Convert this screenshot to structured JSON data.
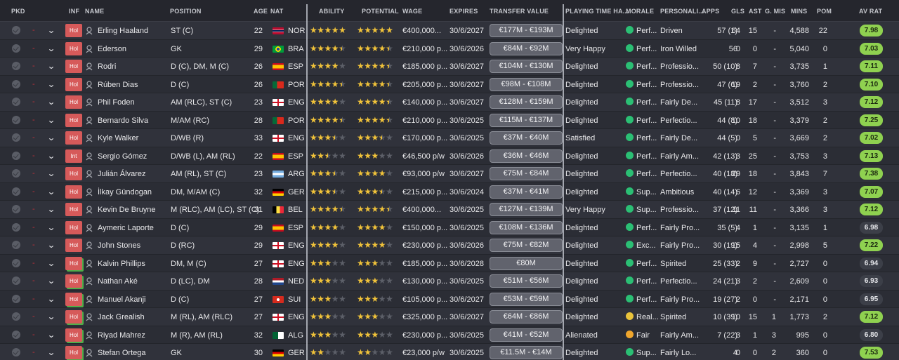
{
  "columns": [
    "PKD",
    "INF",
    "NAME",
    "POSITION",
    "AGE",
    "NAT",
    "ABILITY",
    "POTENTIAL",
    "WAGE",
    "EXPIRES",
    "TRANSFER VALUE",
    "PLAYING TIME HA...",
    "MORALE",
    "PERSONALI...",
    "APPS",
    "GLS",
    "AST",
    "G. MIS",
    "MINS",
    "POM",
    "AV RAT"
  ],
  "colors": {
    "rating_green": "#8fd150",
    "rating_dark": "#3c3f48",
    "badge": "#d65a5a",
    "star": "#f1c33a"
  },
  "players": [
    {
      "inf": "Hol",
      "name": "Erling Haaland",
      "position": "ST (C)",
      "age": "22",
      "flag": "NOR",
      "nat": "NOR",
      "ability": 5,
      "potential": 5,
      "wage": "€400,000...",
      "expires": "30/6/2027",
      "tv": "€177M - €193M",
      "pt": "Delighted",
      "morale": "Perf...",
      "mi": "up",
      "personality": "Driven",
      "apps": "57 (1)",
      "gls": "64",
      "ast": "15",
      "gmis": "-",
      "mins": "4,588",
      "pom": "22",
      "rating": "7.98",
      "rgreen": true
    },
    {
      "inf": "Hol",
      "name": "Ederson",
      "position": "GK",
      "age": "29",
      "flag": "BRA",
      "nat": "BRA",
      "ability": 4.5,
      "potential": 4.5,
      "wage": "€210,000 p...",
      "expires": "30/6/2026",
      "tv": "€84M - €92M",
      "pt": "Very Happy",
      "morale": "Perf...",
      "mi": "up",
      "personality": "Iron Willed",
      "apps": "56",
      "gls": "0",
      "ast": "0",
      "gmis": "-",
      "mins": "5,040",
      "pom": "0",
      "rating": "7.03",
      "rgreen": true
    },
    {
      "inf": "Hol",
      "name": "Rodri",
      "position": "D (C), DM, M (C)",
      "age": "26",
      "flag": "ESP",
      "nat": "ESP",
      "ability": 4,
      "potential": 4.5,
      "wage": "€185,000 p...",
      "expires": "30/6/2027",
      "tv": "€104M - €130M",
      "pt": "Delighted",
      "morale": "Perf...",
      "mi": "up",
      "personality": "Professio...",
      "apps": "50 (10)",
      "gls": "8",
      "ast": "7",
      "gmis": "-",
      "mins": "3,735",
      "pom": "1",
      "rating": "7.11",
      "rgreen": true
    },
    {
      "inf": "Hol",
      "name": "Rúben Dias",
      "position": "D (C)",
      "age": "26",
      "flag": "POR",
      "nat": "POR",
      "ability": 4.5,
      "potential": 4.5,
      "wage": "€205,000 p...",
      "expires": "30/6/2027",
      "tv": "€98M - €108M",
      "pt": "Delighted",
      "morale": "Perf...",
      "mi": "up",
      "personality": "Professio...",
      "apps": "47 (6)",
      "gls": "19",
      "ast": "2",
      "gmis": "-",
      "mins": "3,760",
      "pom": "2",
      "rating": "7.10",
      "rgreen": true
    },
    {
      "inf": "Hol",
      "name": "Phil Foden",
      "position": "AM (RLC), ST (C)",
      "age": "23",
      "flag": "ENG",
      "nat": "ENG",
      "ability": 4,
      "potential": 4.5,
      "wage": "€140,000 p...",
      "expires": "30/6/2027",
      "tv": "€128M - €159M",
      "pt": "Delighted",
      "morale": "Perf...",
      "mi": "up",
      "personality": "Fairly De...",
      "apps": "45 (11)",
      "gls": "8",
      "ast": "17",
      "gmis": "-",
      "mins": "3,512",
      "pom": "3",
      "rating": "7.12",
      "rgreen": true
    },
    {
      "inf": "Hol",
      "name": "Bernardo Silva",
      "position": "M/AM (RC)",
      "age": "28",
      "flag": "POR",
      "nat": "POR",
      "ability": 4.5,
      "potential": 4.5,
      "wage": "€210,000 p...",
      "expires": "30/6/2025",
      "tv": "€115M - €137M",
      "pt": "Delighted",
      "morale": "Perf...",
      "mi": "up",
      "personality": "Perfectio...",
      "apps": "44 (8)",
      "gls": "10",
      "ast": "18",
      "gmis": "-",
      "mins": "3,379",
      "pom": "2",
      "rating": "7.25",
      "rgreen": true
    },
    {
      "inf": "Hol",
      "name": "Kyle Walker",
      "position": "D/WB (R)",
      "age": "33",
      "flag": "ENG",
      "nat": "ENG",
      "ability": 3.5,
      "potential": 3.5,
      "wage": "€170,000 p...",
      "expires": "30/6/2025",
      "tv": "€37M - €40M",
      "pt": "Satisfied",
      "morale": "Perf...",
      "mi": "up",
      "personality": "Fairly De...",
      "apps": "44 (5)",
      "gls": "0",
      "ast": "5",
      "gmis": "-",
      "mins": "3,669",
      "pom": "2",
      "rating": "7.02",
      "rgreen": true
    },
    {
      "inf": "Int",
      "name": "Sergio Gómez",
      "position": "D/WB (L), AM (RL)",
      "age": "22",
      "flag": "ESP",
      "nat": "ESP",
      "ability": 2.5,
      "potential": 3,
      "wage": "€46,500 p/w",
      "expires": "30/6/2026",
      "tv": "€36M - €46M",
      "pt": "Delighted",
      "morale": "Perf...",
      "mi": "up",
      "personality": "Fairly Am...",
      "apps": "42 (13)",
      "gls": "3",
      "ast": "25",
      "gmis": "-",
      "mins": "3,753",
      "pom": "3",
      "rating": "7.13",
      "rgreen": true
    },
    {
      "inf": "Hol",
      "name": "Julián Álvarez",
      "position": "AM (RL), ST (C)",
      "age": "23",
      "flag": "ARG",
      "nat": "ARG",
      "ability": 3.5,
      "potential": 4,
      "wage": "€93,000 p/w",
      "expires": "30/6/2027",
      "tv": "€75M - €84M",
      "pt": "Delighted",
      "morale": "Perf...",
      "mi": "up",
      "personality": "Perfectio...",
      "apps": "40 (18)",
      "gls": "29",
      "ast": "18",
      "gmis": "-",
      "mins": "3,843",
      "pom": "7",
      "rating": "7.38",
      "rgreen": true
    },
    {
      "inf": "Hol",
      "name": "İlkay Gündogan",
      "position": "DM, M/AM (C)",
      "age": "32",
      "flag": "GER",
      "nat": "GER",
      "ability": 3.5,
      "potential": 3.5,
      "wage": "€215,000 p...",
      "expires": "30/6/2024",
      "tv": "€37M - €41M",
      "pt": "Delighted",
      "morale": "Sup...",
      "mi": "up",
      "personality": "Ambitious",
      "apps": "40 (14)",
      "gls": "6",
      "ast": "12",
      "gmis": "-",
      "mins": "3,369",
      "pom": "3",
      "rating": "7.07",
      "rgreen": true
    },
    {
      "inf": "Hol",
      "name": "Kevin De Bruyne",
      "position": "M (RLC), AM (LC), ST (C)",
      "age": "31",
      "flag": "BEL",
      "nat": "BEL",
      "ability": 4.5,
      "potential": 4.5,
      "wage": "€400,000...",
      "expires": "30/6/2025",
      "tv": "€127M - €139M",
      "pt": "Very Happy",
      "morale": "Sup...",
      "mi": "up",
      "personality": "Professio...",
      "apps": "37 (12)",
      "gls": "11",
      "ast": "11",
      "gmis": "-",
      "mins": "3,366",
      "pom": "3",
      "rating": "7.12",
      "rgreen": true
    },
    {
      "inf": "Hol",
      "name": "Aymeric Laporte",
      "position": "D (C)",
      "age": "29",
      "flag": "ESP",
      "nat": "ESP",
      "ability": 4,
      "potential": 4,
      "wage": "€150,000 p...",
      "expires": "30/6/2025",
      "tv": "€108M - €136M",
      "pt": "Delighted",
      "morale": "Perf...",
      "mi": "up",
      "personality": "Fairly Pro...",
      "apps": "35 (5)",
      "gls": "4",
      "ast": "1",
      "gmis": "-",
      "mins": "3,135",
      "pom": "1",
      "rating": "6.98",
      "rgreen": false
    },
    {
      "inf": "Hol",
      "name": "John Stones",
      "position": "D (RC)",
      "age": "29",
      "flag": "ENG",
      "nat": "ENG",
      "ability": 4,
      "potential": 4,
      "wage": "€230,000 p...",
      "expires": "30/6/2026",
      "tv": "€75M - €82M",
      "pt": "Delighted",
      "morale": "Exc...",
      "mi": "up",
      "personality": "Fairly Pro...",
      "apps": "30 (19)",
      "gls": "15",
      "ast": "4",
      "gmis": "-",
      "mins": "2,998",
      "pom": "5",
      "rating": "7.22",
      "rgreen": true
    },
    {
      "inf": "Hol",
      "name": "Kalvin Phillips",
      "position": "DM, M (C)",
      "age": "27",
      "flag": "ENG",
      "nat": "ENG",
      "ability": 3,
      "potential": 3,
      "wage": "€185,000 p...",
      "expires": "30/6/2028",
      "tv": "€80M",
      "pt": "Delighted",
      "morale": "Perf...",
      "mi": "up",
      "personality": "Spirited",
      "apps": "25 (33)",
      "gls": "2",
      "ast": "9",
      "gmis": "-",
      "mins": "2,727",
      "pom": "0",
      "rating": "6.94",
      "rgreen": false
    },
    {
      "inf": "Hol",
      "name": "Nathan Aké",
      "position": "D (LC), DM",
      "age": "28",
      "flag": "NED",
      "nat": "NED",
      "ability": 3,
      "potential": 3,
      "wage": "€130,000 p...",
      "expires": "30/6/2025",
      "tv": "€51M - €56M",
      "pt": "Delighted",
      "morale": "Perf...",
      "mi": "up",
      "personality": "Perfectio...",
      "apps": "24 (21)",
      "gls": "3",
      "ast": "2",
      "gmis": "-",
      "mins": "2,609",
      "pom": "0",
      "rating": "6.93",
      "rgreen": false
    },
    {
      "inf": "Hol",
      "name": "Manuel Akanji",
      "position": "D (C)",
      "age": "27",
      "flag": "SUI",
      "nat": "SUI",
      "ability": 3,
      "potential": 3,
      "wage": "€105,000 p...",
      "expires": "30/6/2027",
      "tv": "€53M - €59M",
      "pt": "Delighted",
      "morale": "Perf...",
      "mi": "up",
      "personality": "Fairly Pro...",
      "apps": "19 (27)",
      "gls": "2",
      "ast": "0",
      "gmis": "-",
      "mins": "2,171",
      "pom": "0",
      "rating": "6.95",
      "rgreen": false
    },
    {
      "inf": "Hol",
      "name": "Jack Grealish",
      "position": "M (RL), AM (RLC)",
      "age": "27",
      "flag": "ENG",
      "nat": "ENG",
      "ability": 3,
      "potential": 3,
      "wage": "€325,000 p...",
      "expires": "30/6/2027",
      "tv": "€64M - €86M",
      "pt": "Delighted",
      "morale": "Real...",
      "mi": "down",
      "personality": "Spirited",
      "apps": "10 (39)",
      "gls": "10",
      "ast": "15",
      "gmis": "1",
      "mins": "1,773",
      "pom": "2",
      "rating": "7.12",
      "rgreen": true
    },
    {
      "inf": "Hol",
      "name": "Riyad Mahrez",
      "position": "M (R), AM (RL)",
      "age": "32",
      "flag": "ALG",
      "nat": "ALG",
      "ability": 3,
      "potential": 3,
      "wage": "€230,000 p...",
      "expires": "30/6/2025",
      "tv": "€41M - €52M",
      "pt": "Alienated",
      "morale": "Fair",
      "mi": "plane",
      "personality": "Fairly Am...",
      "apps": "7 (22)",
      "gls": "3",
      "ast": "1",
      "gmis": "3",
      "mins": "995",
      "pom": "0",
      "rating": "6.80",
      "rgreen": false
    },
    {
      "inf": "Hol",
      "name": "Stefan Ortega",
      "position": "GK",
      "age": "30",
      "flag": "GER",
      "nat": "GER",
      "ability": 2,
      "potential": 2,
      "wage": "€23,000 p/w",
      "expires": "30/6/2025",
      "tv": "€11.5M - €14M",
      "pt": "Delighted",
      "morale": "Sup...",
      "mi": "up",
      "personality": "Fairly Lo...",
      "apps": "4",
      "gls": "0",
      "ast": "0",
      "gmis": "2",
      "mins": "360",
      "pom": "0",
      "rating": "7.53",
      "rgreen": true
    }
  ]
}
